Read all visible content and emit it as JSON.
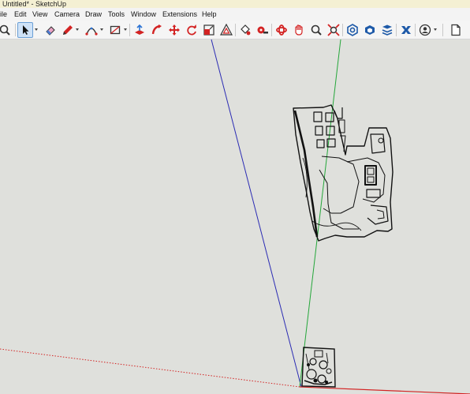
{
  "window": {
    "title": "Untitled* - SketchUp"
  },
  "menu": [
    "ile",
    "Edit",
    "View",
    "Camera",
    "Draw",
    "Tools",
    "Window",
    "Extensions",
    "Help"
  ],
  "toolbar": {
    "tools": [
      "zoom-icon",
      "select-icon",
      "eraser-icon",
      "pencil-icon",
      "arc-icon",
      "rectangle-icon",
      "push-pull-icon",
      "follow-me-icon",
      "move-icon",
      "rotate-icon",
      "scale-icon",
      "offset-icon",
      "paint-bucket-icon",
      "tape-measure-icon",
      "orbit-icon",
      "pan-icon",
      "zoom-tool-icon",
      "zoom-extents-icon",
      "warehouse-icon",
      "extension-warehouse-icon",
      "layout-icon",
      "extension-manager-icon",
      "account-icon",
      "new-file-icon"
    ],
    "active_tool": "select"
  },
  "colors": {
    "title_bar": "#f4f0d3",
    "background": "#dfe0dc",
    "axis_blue": "#2b2bb3",
    "axis_green": "#24a63a",
    "axis_red": "#d32323"
  }
}
